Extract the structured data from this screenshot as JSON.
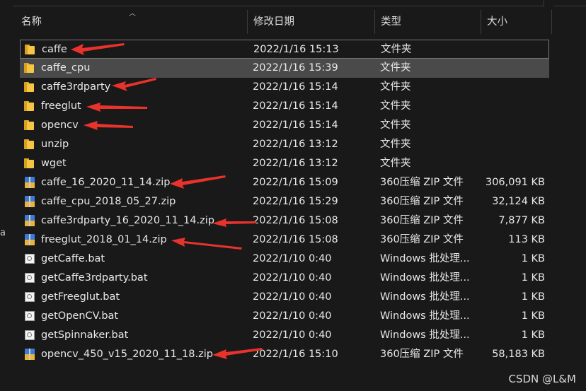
{
  "header": {
    "columns": [
      {
        "label": "名称"
      },
      {
        "label": "修改日期"
      },
      {
        "label": "类型"
      },
      {
        "label": "大小"
      }
    ]
  },
  "files": [
    {
      "name": "caffe",
      "date": "2022/1/16 15:13",
      "type": "文件夹",
      "size": "",
      "icon": "folder-icon",
      "state": "selected"
    },
    {
      "name": "caffe_cpu",
      "date": "2022/1/16 15:39",
      "type": "文件夹",
      "size": "",
      "icon": "folder-icon",
      "state": "hover"
    },
    {
      "name": "caffe3rdparty",
      "date": "2022/1/16 15:14",
      "type": "文件夹",
      "size": "",
      "icon": "folder-icon",
      "state": ""
    },
    {
      "name": "freeglut",
      "date": "2022/1/16 15:14",
      "type": "文件夹",
      "size": "",
      "icon": "folder-icon",
      "state": ""
    },
    {
      "name": "opencv",
      "date": "2022/1/16 15:14",
      "type": "文件夹",
      "size": "",
      "icon": "folder-icon",
      "state": ""
    },
    {
      "name": "unzip",
      "date": "2022/1/16 13:12",
      "type": "文件夹",
      "size": "",
      "icon": "folder-icon",
      "state": ""
    },
    {
      "name": "wget",
      "date": "2022/1/16 13:12",
      "type": "文件夹",
      "size": "",
      "icon": "folder-icon",
      "state": ""
    },
    {
      "name": "caffe_16_2020_11_14.zip",
      "date": "2022/1/16 15:09",
      "type": "360压缩 ZIP 文件",
      "size": "306,091 KB",
      "icon": "zip-archive-icon",
      "state": ""
    },
    {
      "name": "caffe_cpu_2018_05_27.zip",
      "date": "2022/1/16 15:29",
      "type": "360压缩 ZIP 文件",
      "size": "32,124 KB",
      "icon": "zip-archive-icon",
      "state": ""
    },
    {
      "name": "caffe3rdparty_16_2020_11_14.zip",
      "date": "2022/1/16 15:08",
      "type": "360压缩 ZIP 文件",
      "size": "7,877 KB",
      "icon": "zip-archive-icon",
      "state": ""
    },
    {
      "name": "freeglut_2018_01_14.zip",
      "date": "2022/1/16 15:08",
      "type": "360压缩 ZIP 文件",
      "size": "113 KB",
      "icon": "zip-archive-icon",
      "state": ""
    },
    {
      "name": "getCaffe.bat",
      "date": "2022/1/10 0:40",
      "type": "Windows 批处理...",
      "size": "1 KB",
      "icon": "batch-file-icon",
      "state": ""
    },
    {
      "name": "getCaffe3rdparty.bat",
      "date": "2022/1/10 0:40",
      "type": "Windows 批处理...",
      "size": "1 KB",
      "icon": "batch-file-icon",
      "state": ""
    },
    {
      "name": "getFreeglut.bat",
      "date": "2022/1/10 0:40",
      "type": "Windows 批处理...",
      "size": "1 KB",
      "icon": "batch-file-icon",
      "state": ""
    },
    {
      "name": "getOpenCV.bat",
      "date": "2022/1/10 0:40",
      "type": "Windows 批处理...",
      "size": "1 KB",
      "icon": "batch-file-icon",
      "state": ""
    },
    {
      "name": "getSpinnaker.bat",
      "date": "2022/1/10 0:40",
      "type": "Windows 批处理...",
      "size": "1 KB",
      "icon": "batch-file-icon",
      "state": ""
    },
    {
      "name": "opencv_450_v15_2020_11_18.zip",
      "date": "2022/1/16 15:10",
      "type": "360压缩 ZIP 文件",
      "size": "58,183 KB",
      "icon": "zip-archive-icon",
      "state": ""
    }
  ],
  "side_char": "a",
  "watermark": "CSDN @L&M",
  "colors": {
    "background": "#191919",
    "text": "#e8e8e8",
    "hover_row": "#4a4a4a",
    "annotation_arrow": "#e8322c"
  }
}
